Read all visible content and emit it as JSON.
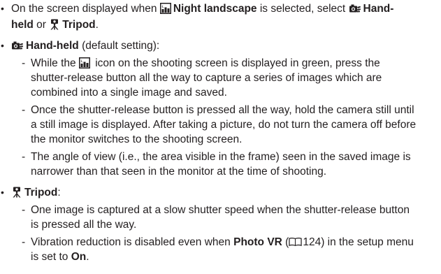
{
  "bullet_char": "•",
  "dash_char": "-",
  "icons": {
    "night_landscape": "night-landscape-icon",
    "hand_held": "hand-held-icon",
    "tripod": "tripod-icon",
    "manual_ref": "manual-book-icon"
  },
  "accent_color": "#231f20",
  "b1": {
    "seg1": "On the screen displayed when ",
    "bold1": "Night landscape",
    "seg2": " is selected, select ",
    "bold2": "Hand-",
    "bold3": "held",
    "seg3": " or ",
    "bold4": "Tripod",
    "seg4": "."
  },
  "b2": {
    "title": "Hand-held",
    "note": " (default setting):",
    "d1": {
      "l1a": "While the ",
      "l1b": " icon on the shooting screen is displayed in green, press the",
      "l2": "shutter-release button all the way to capture a series of images which are",
      "l3": "combined into a single image and saved."
    },
    "d2": {
      "l1": "Once the shutter-release button is pressed all the way, hold the camera still until",
      "l2": "a still image is displayed. After taking a picture, do not turn the camera off before",
      "l3": "the monitor switches to the shooting screen."
    },
    "d3": {
      "l1": "The angle of view (i.e., the area visible in the frame) seen in the saved image is",
      "l2": "narrower than that seen in the monitor at the time of shooting."
    }
  },
  "b3": {
    "title": "Tripod",
    "colon": ":",
    "d1": {
      "l1": "One image is captured at a slow shutter speed when the shutter-release button",
      "l2": "is pressed all the way."
    },
    "d2": {
      "l1a": "Vibration reduction is disabled even when ",
      "l1b": "Photo VR",
      "l1c": " (",
      "l1d": "124) in the setup menu",
      "l2a": "is set to ",
      "l2b": "On",
      "l2c": "."
    }
  }
}
